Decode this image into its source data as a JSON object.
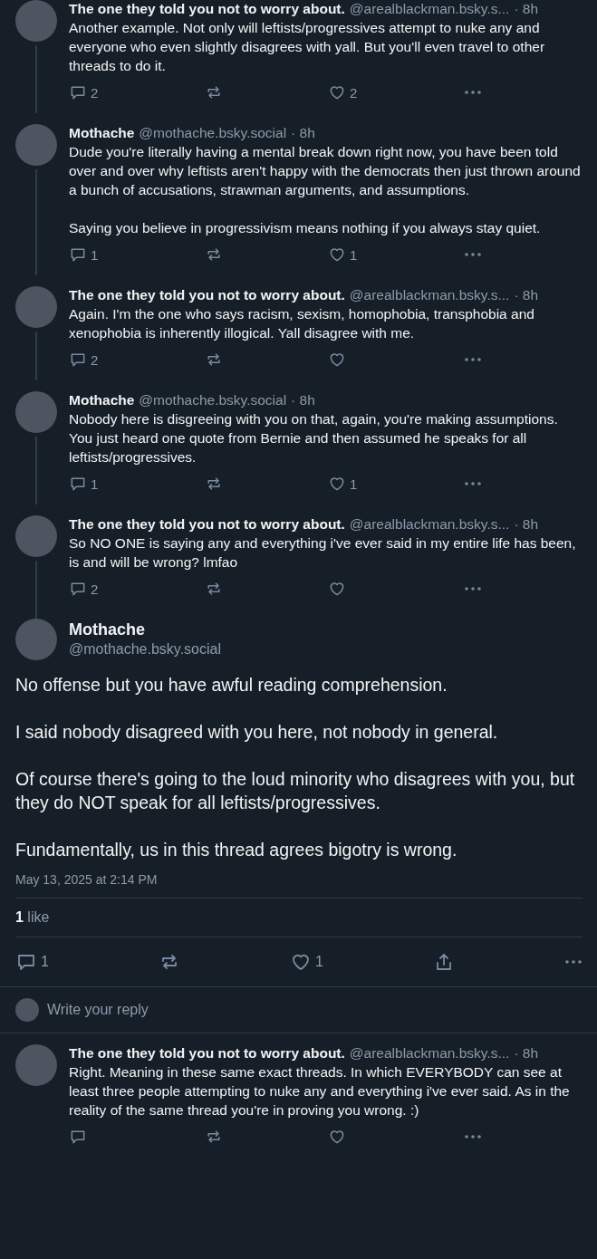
{
  "thread_posts": [
    {
      "author": "The one they told you not to worry about.",
      "handle": "@arealblackman.bsky.s...",
      "time": "· 8h",
      "paragraphs": [
        "Another example. Not only will leftists/progressives attempt to nuke any and everyone who even slightly disagrees with yall. But you'll even travel to other threads to do it."
      ],
      "reply_count": "2",
      "like_count": "2"
    },
    {
      "author": "Mothache",
      "handle": "@mothache.bsky.social",
      "time": "· 8h",
      "paragraphs": [
        "Dude you're literally having a mental break down right now, you have been told over and over why leftists aren't happy with the democrats then just thrown around a bunch of accusations, strawman arguments, and assumptions.",
        "Saying you believe in progressivism means nothing if you always stay quiet."
      ],
      "reply_count": "1",
      "like_count": "1"
    },
    {
      "author": "The one they told you not to worry about.",
      "handle": "@arealblackman.bsky.s...",
      "time": "· 8h",
      "paragraphs": [
        "Again. I'm the one who says racism, sexism, homophobia, transphobia and xenophobia is inherently illogical. Yall disagree with me."
      ],
      "reply_count": "2"
    },
    {
      "author": "Mothache",
      "handle": "@mothache.bsky.social",
      "time": "· 8h",
      "paragraphs": [
        "Nobody here is disgreeing with you on that, again, you're making assumptions. You just heard one quote from Bernie and then assumed he speaks for all leftists/progressives."
      ],
      "reply_count": "1",
      "like_count": "1"
    },
    {
      "author": "The one they told you not to worry about.",
      "handle": "@arealblackman.bsky.s...",
      "time": "· 8h",
      "paragraphs": [
        "So NO ONE is saying any and everything i've ever said in my entire life has been, is and will be wrong? lmfao"
      ],
      "reply_count": "2"
    }
  ],
  "main_post": {
    "author": "Mothache",
    "handle": "@mothache.bsky.social",
    "paragraphs": [
      "No offense but you have awful reading comprehension.",
      "I said nobody disagreed with you here, not nobody in general.",
      "Of course there's going to the loud minority who disagrees with you, but they do NOT speak for all leftists/progressives.",
      "Fundamentally, us in this thread agrees bigotry is wrong."
    ],
    "timestamp": "May 13, 2025 at 2:14 PM",
    "likes": {
      "count": "1",
      "label": "like"
    },
    "reply_count": "1",
    "like_count": "1"
  },
  "reply_box": {
    "placeholder": "Write your reply"
  },
  "replies": [
    {
      "author": "The one they told you not to worry about.",
      "handle": "@arealblackman.bsky.s...",
      "time": "· 8h",
      "paragraphs": [
        "Right. Meaning in these same exact threads. In which EVERYBODY can see at least three people attempting to nuke any and everything i've ever said. As in the reality of the same thread you're in proving you wrong. :)"
      ]
    }
  ]
}
